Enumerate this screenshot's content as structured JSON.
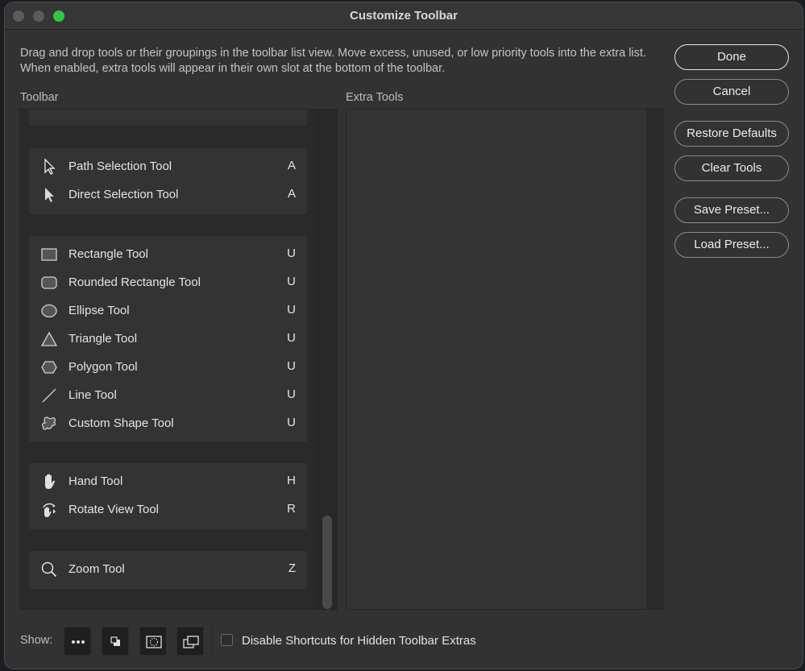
{
  "window": {
    "title": "Customize Toolbar",
    "description": "Drag and drop tools or their groupings in the toolbar list view. Move excess, unused, or low priority tools into the extra list. When enabled, extra tools will appear in their own slot at the bottom of the toolbar.",
    "traffic_lights": [
      "close-disabled",
      "minimize-disabled",
      "zoom"
    ],
    "accent_color": "#2ec840"
  },
  "toolbar_panel": {
    "label": "Toolbar",
    "groups": [
      {
        "tools": [
          {
            "name": "Path Selection Tool",
            "shortcut": "A",
            "icon": "path-selection-arrow-icon"
          },
          {
            "name": "Direct Selection Tool",
            "shortcut": "A",
            "icon": "direct-selection-arrow-icon"
          }
        ]
      },
      {
        "tools": [
          {
            "name": "Rectangle Tool",
            "shortcut": "U",
            "icon": "rectangle-icon"
          },
          {
            "name": "Rounded Rectangle Tool",
            "shortcut": "U",
            "icon": "rounded-rectangle-icon"
          },
          {
            "name": "Ellipse Tool",
            "shortcut": "U",
            "icon": "ellipse-icon"
          },
          {
            "name": "Triangle Tool",
            "shortcut": "U",
            "icon": "triangle-icon"
          },
          {
            "name": "Polygon Tool",
            "shortcut": "U",
            "icon": "polygon-icon"
          },
          {
            "name": "Line Tool",
            "shortcut": "U",
            "icon": "line-icon"
          },
          {
            "name": "Custom Shape Tool",
            "shortcut": "U",
            "icon": "custom-shape-icon"
          }
        ]
      },
      {
        "tools": [
          {
            "name": "Hand Tool",
            "shortcut": "H",
            "icon": "hand-icon"
          },
          {
            "name": "Rotate View Tool",
            "shortcut": "R",
            "icon": "rotate-view-icon"
          }
        ]
      },
      {
        "tools": [
          {
            "name": "Zoom Tool",
            "shortcut": "Z",
            "icon": "zoom-magnifier-icon"
          }
        ]
      }
    ]
  },
  "extra_panel": {
    "label": "Extra Tools",
    "items": []
  },
  "buttons": {
    "done": "Done",
    "cancel": "Cancel",
    "restore_defaults": "Restore Defaults",
    "clear_tools": "Clear Tools",
    "save_preset": "Save Preset...",
    "load_preset": "Load Preset..."
  },
  "footer": {
    "show_label": "Show:",
    "show_buttons": [
      "more-dots-icon",
      "swap-colors-icon",
      "quick-mask-icon",
      "screen-mode-icon"
    ],
    "checkbox_label": "Disable Shortcuts for Hidden Toolbar Extras",
    "checkbox_checked": false
  }
}
